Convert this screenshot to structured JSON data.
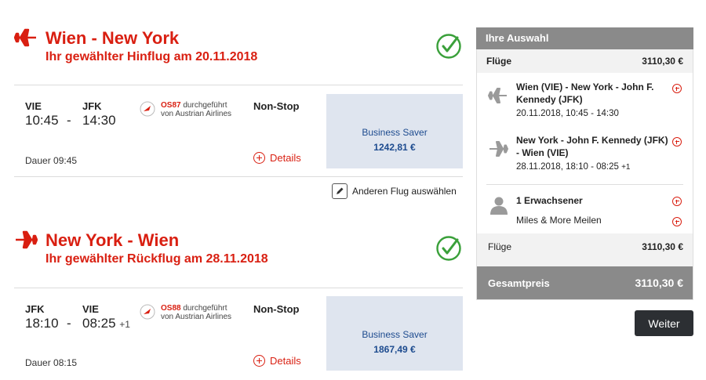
{
  "outbound": {
    "title": "Wien - New York",
    "subtitle": "Ihr gewählter Hinflug am 20.11.2018",
    "from_code": "VIE",
    "to_code": "JFK",
    "dep_time": "10:45",
    "separator": "-",
    "arr_time": "14:30",
    "flight_no": "OS87",
    "operated": "durchgeführt",
    "operator": "von Austrian Airlines",
    "stops": "Non-Stop",
    "duration": "Dauer 09:45",
    "details": "Details",
    "fare_name": "Business Saver",
    "fare_price": "1242,81 €"
  },
  "change_flight": "Anderen Flug auswählen",
  "return": {
    "title": "New York - Wien",
    "subtitle": "Ihr gewählter Rückflug am 28.11.2018",
    "from_code": "JFK",
    "to_code": "VIE",
    "dep_time": "18:10",
    "separator": "-",
    "arr_time": "08:25",
    "arr_plus": "+1",
    "flight_no": "OS88",
    "operated": "durchgeführt",
    "operator": "von Austrian Airlines",
    "stops": "Non-Stop",
    "duration": "Dauer 08:15",
    "details": "Details",
    "fare_name": "Business Saver",
    "fare_price": "1867,49 €"
  },
  "sidebar": {
    "header": "Ihre Auswahl",
    "flights_label": "Flüge",
    "flights_value": "3110,30 €",
    "seg1_route": "Wien (VIE) - New York - John F. Kennedy (JFK)",
    "seg1_when": "20.11.2018, 10:45 - 14:30",
    "seg2_route": "New York - John F. Kennedy (JFK) - Wien (VIE)",
    "seg2_when": "28.11.2018, 18:10 - 08:25",
    "seg2_plus": "+1",
    "passenger": "1 Erwachsener",
    "miles": "Miles & More Meilen",
    "sum_label": "Flüge",
    "sum_value": "3110,30 €",
    "total_label": "Gesamtpreis",
    "total_value": "3110,30 €",
    "continue": "Weiter"
  },
  "icons": {
    "plane": "plane-icon",
    "check": "check-circle-icon",
    "plus": "plus-circle-icon",
    "edit": "pencil-icon",
    "person": "person-icon",
    "airline_logo": "austrian-airlines-logo"
  },
  "colors": {
    "brand_red": "#d91f11",
    "fare_blue": "#1d4b8f",
    "fare_bg": "#dfe5ef",
    "check_green": "#3aa03a",
    "sidebar_gray": "#8a8a8a",
    "button_dark": "#2c2f33"
  }
}
